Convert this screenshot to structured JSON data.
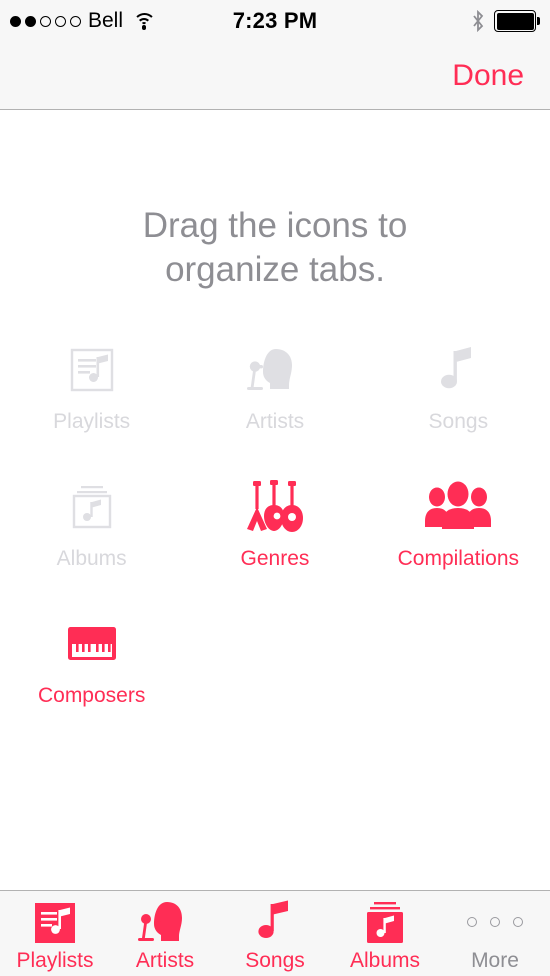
{
  "status_bar": {
    "carrier": "Bell",
    "signal_bars_filled": 2,
    "signal_bars_total": 5,
    "wifi_icon": "wifi-icon",
    "time": "7:23 PM",
    "bluetooth_icon": "bluetooth-icon",
    "battery_icon": "battery-full-icon"
  },
  "nav_bar": {
    "done_label": "Done"
  },
  "main": {
    "prompt_line1": "Drag the icons to",
    "prompt_line2": "organize tabs.",
    "icons": [
      {
        "label": "Playlists",
        "icon": "playlists-icon",
        "state": "inactive"
      },
      {
        "label": "Artists",
        "icon": "artists-icon",
        "state": "inactive"
      },
      {
        "label": "Songs",
        "icon": "songs-icon",
        "state": "inactive"
      },
      {
        "label": "Albums",
        "icon": "albums-icon",
        "state": "inactive"
      },
      {
        "label": "Genres",
        "icon": "genres-icon",
        "state": "active"
      },
      {
        "label": "Compilations",
        "icon": "compilations-icon",
        "state": "active"
      },
      {
        "label": "Composers",
        "icon": "composers-icon",
        "state": "active"
      }
    ]
  },
  "tab_bar": {
    "tabs": [
      {
        "label": "Playlists",
        "icon": "playlists-icon",
        "selected": true
      },
      {
        "label": "Artists",
        "icon": "artists-icon",
        "selected": true
      },
      {
        "label": "Songs",
        "icon": "songs-icon",
        "selected": true
      },
      {
        "label": "Albums",
        "icon": "albums-icon",
        "selected": true
      },
      {
        "label": "More",
        "icon": "more-dots-icon",
        "selected": false
      }
    ]
  },
  "colors": {
    "accent": "#FF2D55",
    "inactive_grey": "#D8D8DC",
    "prompt_grey": "#8E8E93",
    "bar_background": "#F7F7F7",
    "bar_border": "#B2B2B2"
  }
}
